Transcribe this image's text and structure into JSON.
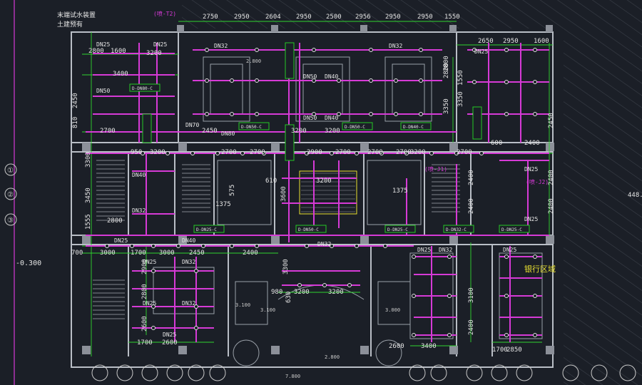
{
  "header": {
    "note_1": "末端试水装置",
    "note_2": "土建预有",
    "ref_1": "(喷-T2)"
  },
  "zone_label": "银行区域",
  "side_labels": {
    "elevation": "-0.300",
    "right_ref": "448.1",
    "ref_j1": "(喷-J1)",
    "ref_j2": "(喷-J2)"
  },
  "top_dims": [
    "2750",
    "2950",
    "2604",
    "2950",
    "2500",
    "2956",
    "2950",
    "2950",
    "1550"
  ],
  "top_right_dims": [
    "2650",
    "2950",
    "1600"
  ],
  "left_col_dims": [
    "2450",
    "810",
    "3300",
    "3450",
    "1555",
    "700",
    "2900",
    "2800",
    "2600"
  ],
  "left_row_dims": [
    "2800",
    "1600",
    "3200",
    "3400",
    "2700",
    "2450",
    "2700",
    "3200",
    "2800",
    "3000",
    "1700",
    "3000",
    "1700",
    "2600",
    "2450",
    "2400"
  ],
  "mid_dims": [
    "950",
    "2700",
    "2700",
    "2900",
    "2700",
    "2700",
    "2700",
    "3200",
    "3200",
    "3200",
    "2800",
    "3350"
  ],
  "core_dims": [
    "1375",
    "575",
    "610",
    "3600",
    "3200",
    "1375",
    "980",
    "630",
    "3200",
    "3200",
    "3300"
  ],
  "right_col_dims": [
    "2800",
    "1550",
    "3350",
    "2450",
    "2400",
    "600",
    "2400",
    "2400",
    "2400",
    "2400",
    "3100",
    "2400",
    "2850",
    "3400",
    "1700",
    "2600"
  ],
  "pipe_labels": {
    "dn25": "DN25",
    "dn32": "DN32",
    "dn40": "DN40",
    "dn50": "DN50",
    "dn70": "DN70",
    "dn80": "DN80"
  },
  "tags": [
    "D-DN80-C",
    "D-DN50-C",
    "D-DN40-C",
    "D-DN25-C",
    "D-DN32-C"
  ],
  "grid_markers": [
    "①",
    "②",
    "③"
  ],
  "elevation_marks": [
    "3.100",
    "3.100",
    "3.000",
    "2.800",
    "7.800",
    "2.800"
  ],
  "colors": {
    "background": "#1b1f27",
    "pipe": "#d63ad6",
    "dim": "#2fd62f",
    "wall": "#c8c8c8",
    "text": "#e6e6e6",
    "highlight": "#e8e030",
    "tag": "#26c826"
  }
}
